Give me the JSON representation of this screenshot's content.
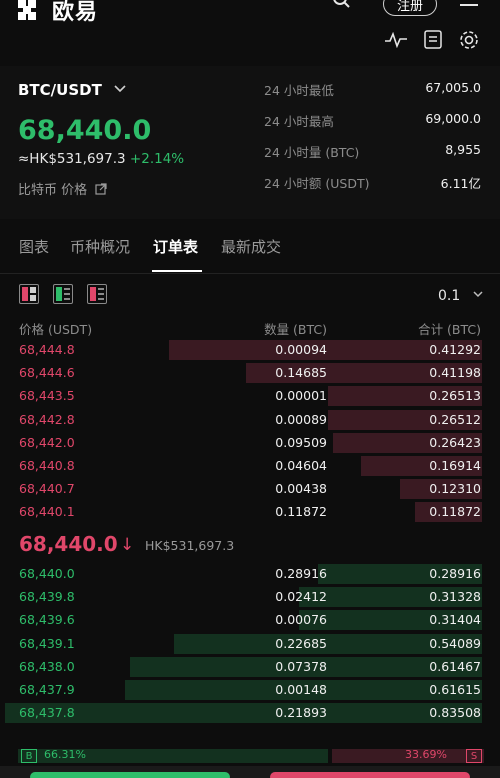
{
  "header": {
    "logo_text": "欧易",
    "register_label": "注册",
    "icons": [
      "search-icon",
      "menu-icon",
      "chart-line-icon",
      "clipboard-icon",
      "gear-icon"
    ]
  },
  "summary": {
    "pair": "BTC/USDT",
    "last_price": "68,440.0",
    "fiat_price": "≈HK$531,697.3",
    "change": "+2.14%",
    "info_link": "比特币 价格",
    "stats": [
      {
        "label": "24 小时最低",
        "value": "67,005.0"
      },
      {
        "label": "24 小时最高",
        "value": "69,000.0"
      },
      {
        "label": "24 小时量 (BTC)",
        "value": "8,955"
      },
      {
        "label": "24 小时额 (USDT)",
        "value": "6.11亿"
      }
    ]
  },
  "tabs": [
    "图表",
    "币种概况",
    "订单表",
    "最新成交"
  ],
  "active_tab": "订单表",
  "book": {
    "precision": "0.1",
    "headers": {
      "price": "价格 (USDT)",
      "qty": "数量 (BTC)",
      "total": "合计 (BTC)"
    },
    "asks": [
      {
        "price": "68,444.8",
        "qty": "0.00094",
        "total": "0.41292",
        "depth": 0.65
      },
      {
        "price": "68,444.6",
        "qty": "0.14685",
        "total": "0.41198",
        "depth": 0.49
      },
      {
        "price": "68,443.5",
        "qty": "0.00001",
        "total": "0.26513",
        "depth": 0.32
      },
      {
        "price": "68,442.8",
        "qty": "0.00089",
        "total": "0.26512",
        "depth": 0.32
      },
      {
        "price": "68,442.0",
        "qty": "0.09509",
        "total": "0.26423",
        "depth": 0.31
      },
      {
        "price": "68,440.8",
        "qty": "0.04604",
        "total": "0.16914",
        "depth": 0.25
      },
      {
        "price": "68,440.7",
        "qty": "0.00438",
        "total": "0.12310",
        "depth": 0.17
      },
      {
        "price": "68,440.1",
        "qty": "0.11872",
        "total": "0.11872",
        "depth": 0.14
      }
    ],
    "mid_price": "68,440.0",
    "mid_fiat": "HK$531,697.3",
    "bids": [
      {
        "price": "68,440.0",
        "qty": "0.28916",
        "total": "0.28916",
        "depth": 0.34
      },
      {
        "price": "68,439.8",
        "qty": "0.02412",
        "total": "0.31328",
        "depth": 0.38
      },
      {
        "price": "68,439.6",
        "qty": "0.00076",
        "total": "0.31404",
        "depth": 0.38
      },
      {
        "price": "68,439.1",
        "qty": "0.22685",
        "total": "0.54089",
        "depth": 0.64
      },
      {
        "price": "68,438.0",
        "qty": "0.07378",
        "total": "0.61467",
        "depth": 0.73
      },
      {
        "price": "68,437.9",
        "qty": "0.00148",
        "total": "0.61615",
        "depth": 0.74
      },
      {
        "price": "68,437.8",
        "qty": "0.21893",
        "total": "0.83508",
        "depth": 0.99
      }
    ]
  },
  "ratio": {
    "buy_label": "B",
    "sell_label": "S",
    "buy_pct": "66.31%",
    "sell_pct": "33.69%"
  }
}
